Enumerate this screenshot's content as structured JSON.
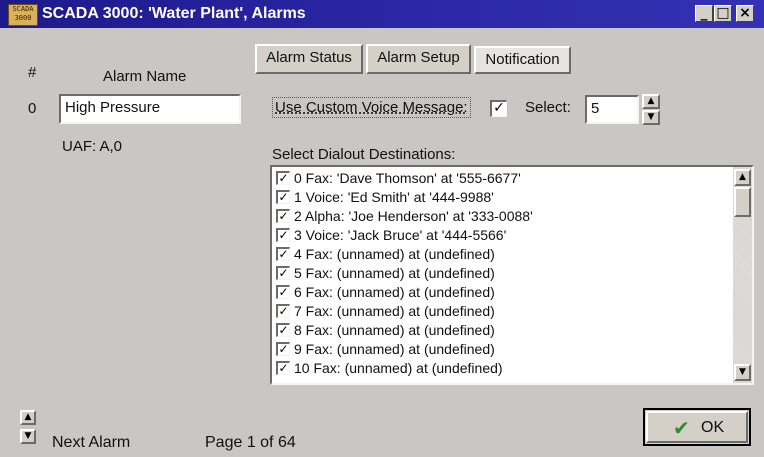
{
  "window": {
    "title": "SCADA 3000: 'Water Plant', Alarms",
    "icon_text": "SCADA 3000",
    "buttons": {
      "minimize": "_",
      "maximize": "□",
      "close": "×"
    }
  },
  "tabs": [
    {
      "label": "Alarm Status"
    },
    {
      "label": "Alarm Setup"
    },
    {
      "label": "Notification",
      "active": true
    }
  ],
  "left_panel": {
    "col_number": "#",
    "col_name": "Alarm Name",
    "row_number": "0",
    "alarm_name": "High Pressure",
    "uaf": "UAF: A,0"
  },
  "notification": {
    "custom_voice_label": "Use Custom Voice Message:",
    "custom_voice_checked": true,
    "select_label": "Select:",
    "select_value": "5",
    "destinations_label": "Select Dialout Destinations:",
    "destinations": [
      {
        "text": "0 Fax: 'Dave Thomson' at '555-6677'",
        "checked": true
      },
      {
        "text": "1 Voice: 'Ed Smith' at '444-9988'",
        "checked": true
      },
      {
        "text": "2 Alpha: 'Joe Henderson' at '333-0088'",
        "checked": true
      },
      {
        "text": "3 Voice: 'Jack Bruce' at '444-5566'",
        "checked": true
      },
      {
        "text": "4 Fax: (unnamed) at (undefined)",
        "checked": true
      },
      {
        "text": "5 Fax: (unnamed) at (undefined)",
        "checked": true
      },
      {
        "text": "6 Fax: (unnamed) at (undefined)",
        "checked": true
      },
      {
        "text": "7 Fax: (unnamed) at (undefined)",
        "checked": true
      },
      {
        "text": "8 Fax: (unnamed) at (undefined)",
        "checked": true
      },
      {
        "text": "9 Fax: (unnamed) at (undefined)",
        "checked": true
      },
      {
        "text": "10 Fax: (unnamed) at (undefined)",
        "checked": true
      }
    ]
  },
  "footer": {
    "next_alarm": "Next Alarm",
    "page": "Page 1 of 64",
    "ok": "OK"
  },
  "colors": {
    "title_bar": "#1d1a8c",
    "window_bg": "#c9c7c4",
    "ok_check": "#2e8b2e"
  },
  "icons": {
    "app": "scada-app-icon",
    "check": "checkmark-icon",
    "up": "arrow-up-icon",
    "down": "arrow-down-icon"
  }
}
